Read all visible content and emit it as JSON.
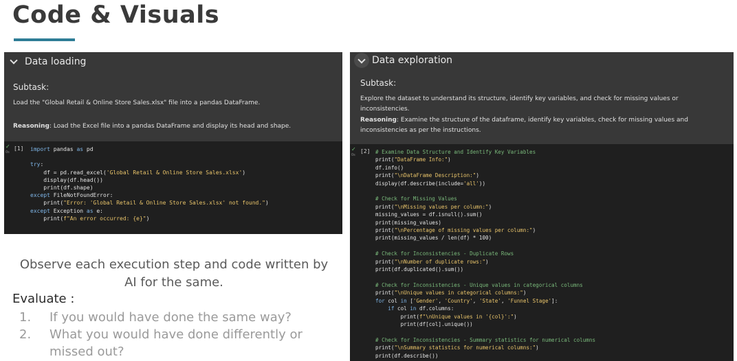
{
  "slide": {
    "title": "Code & Visuals",
    "accent_color": "#2e7d96"
  },
  "loading": {
    "heading": "Data loading",
    "subtask_label": "Subtask:",
    "subtask_text": "Load the \"Global Retail & Online Store Sales.xlsx\" file into a pandas DataFrame.",
    "reasoning_label": "Reasoning",
    "reasoning_text": ": Load the Excel file into a pandas DataFrame and display its head and shape.",
    "cell_number": "[1]"
  },
  "exploration": {
    "heading": "Data exploration",
    "subtask_label": "Subtask:",
    "subtask_text": "Explore the dataset to understand its structure, identify key variables, and check for missing values or inconsistencies.",
    "reasoning_label": "Reasoning",
    "reasoning_text": ": Examine the structure of the dataframe, identify key variables, check for missing values and inconsistencies as per the instructions.",
    "cell_number": "[2]"
  },
  "bottom": {
    "observe": "Observe each execution step and code written by AI for the same.",
    "evaluate": "Evaluate :",
    "q1_num": "1.",
    "q1": "If you would have done the same way?",
    "q2_num": "2.",
    "q2": "What you would have done differently or missed out?"
  }
}
